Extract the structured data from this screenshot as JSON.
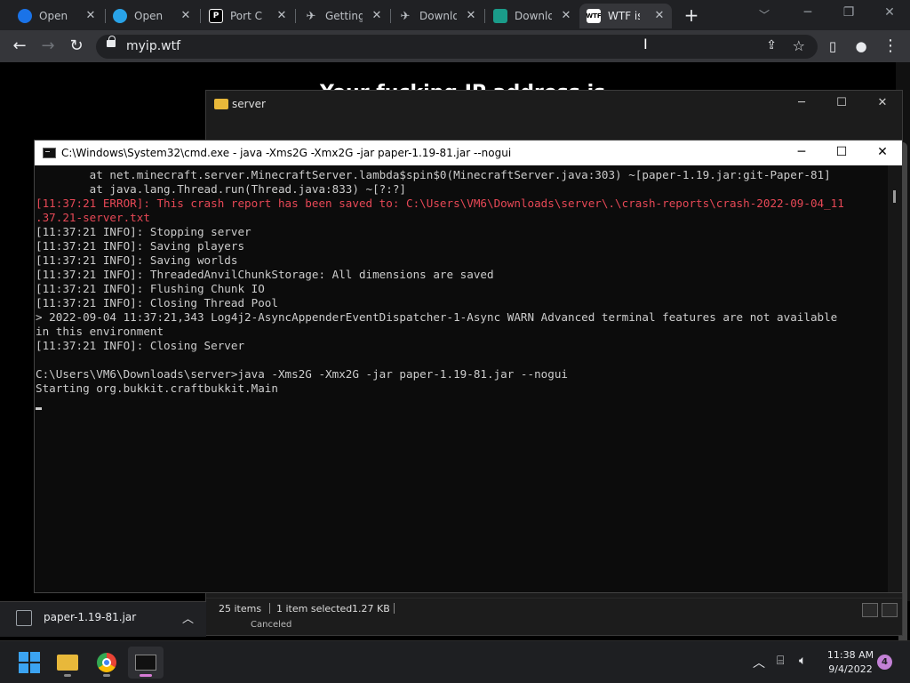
{
  "browser": {
    "tabs": [
      {
        "title": "Open Ports",
        "favicon": "O",
        "color": "#1a73e8"
      },
      {
        "title": "Open Ports",
        "favicon": "O",
        "color": "#29a3e8"
      },
      {
        "title": "Port Checker",
        "favicon": "P",
        "color": "#000000"
      },
      {
        "title": "Getting Started",
        "favicon": "G",
        "color": "#5f6368"
      },
      {
        "title": "Download",
        "favicon": "D",
        "color": "#5f6368"
      },
      {
        "title": "Download",
        "favicon": "D",
        "color": "#1a9c8a"
      },
      {
        "title": "WTF is my IP",
        "favicon": "WTF",
        "color": "#ffffff"
      }
    ],
    "new_tab": "+",
    "url": "myip.wtf"
  },
  "page": {
    "heading": "Your fucking IP address is"
  },
  "explorer": {
    "title": "server",
    "status": {
      "items": "25 items",
      "selected": "1 item selected",
      "size": "1.27 KB"
    },
    "canceled": "Canceled"
  },
  "cmd": {
    "title": "C:\\Windows\\System32\\cmd.exe - java  -Xms2G -Xmx2G -jar paper-1.19-81.jar --nogui",
    "lines": [
      {
        "text": "        at net.minecraft.server.MinecraftServer.lambda$spin$0(MinecraftServer.java:303) ~[paper-1.19.jar:git-Paper-81]",
        "err": false
      },
      {
        "text": "        at java.lang.Thread.run(Thread.java:833) ~[?:?]",
        "err": false
      },
      {
        "text": "[11:37:21 ERROR]: This crash report has been saved to: C:\\Users\\VM6\\Downloads\\server\\.\\crash-reports\\crash-2022-09-04_11",
        "err": true
      },
      {
        "text": ".37.21-server.txt",
        "err": true
      },
      {
        "text": "[11:37:21 INFO]: Stopping server",
        "err": false
      },
      {
        "text": "[11:37:21 INFO]: Saving players",
        "err": false
      },
      {
        "text": "[11:37:21 INFO]: Saving worlds",
        "err": false
      },
      {
        "text": "[11:37:21 INFO]: ThreadedAnvilChunkStorage: All dimensions are saved",
        "err": false
      },
      {
        "text": "[11:37:21 INFO]: Flushing Chunk IO",
        "err": false
      },
      {
        "text": "[11:37:21 INFO]: Closing Thread Pool",
        "err": false
      },
      {
        "text": "> 2022-09-04 11:37:21,343 Log4j2-AsyncAppenderEventDispatcher-1-Async WARN Advanced terminal features are not available",
        "err": false
      },
      {
        "text": "in this environment",
        "err": false
      },
      {
        "text": "[11:37:21 INFO]: Closing Server",
        "err": false
      },
      {
        "text": "",
        "err": false
      },
      {
        "text": "C:\\Users\\VM6\\Downloads\\server>java -Xms2G -Xmx2G -jar paper-1.19-81.jar --nogui",
        "err": false
      },
      {
        "text": "Starting org.bukkit.craftbukkit.Main",
        "err": false
      }
    ]
  },
  "downloads": {
    "file": "paper-1.19-81.jar"
  },
  "taskbar": {
    "time": "11:38 AM",
    "date": "9/4/2022",
    "notifications": "4"
  },
  "colors": {
    "error_text": "#e74856",
    "console_text": "#cccccc",
    "accent": "#3ba3f2"
  }
}
